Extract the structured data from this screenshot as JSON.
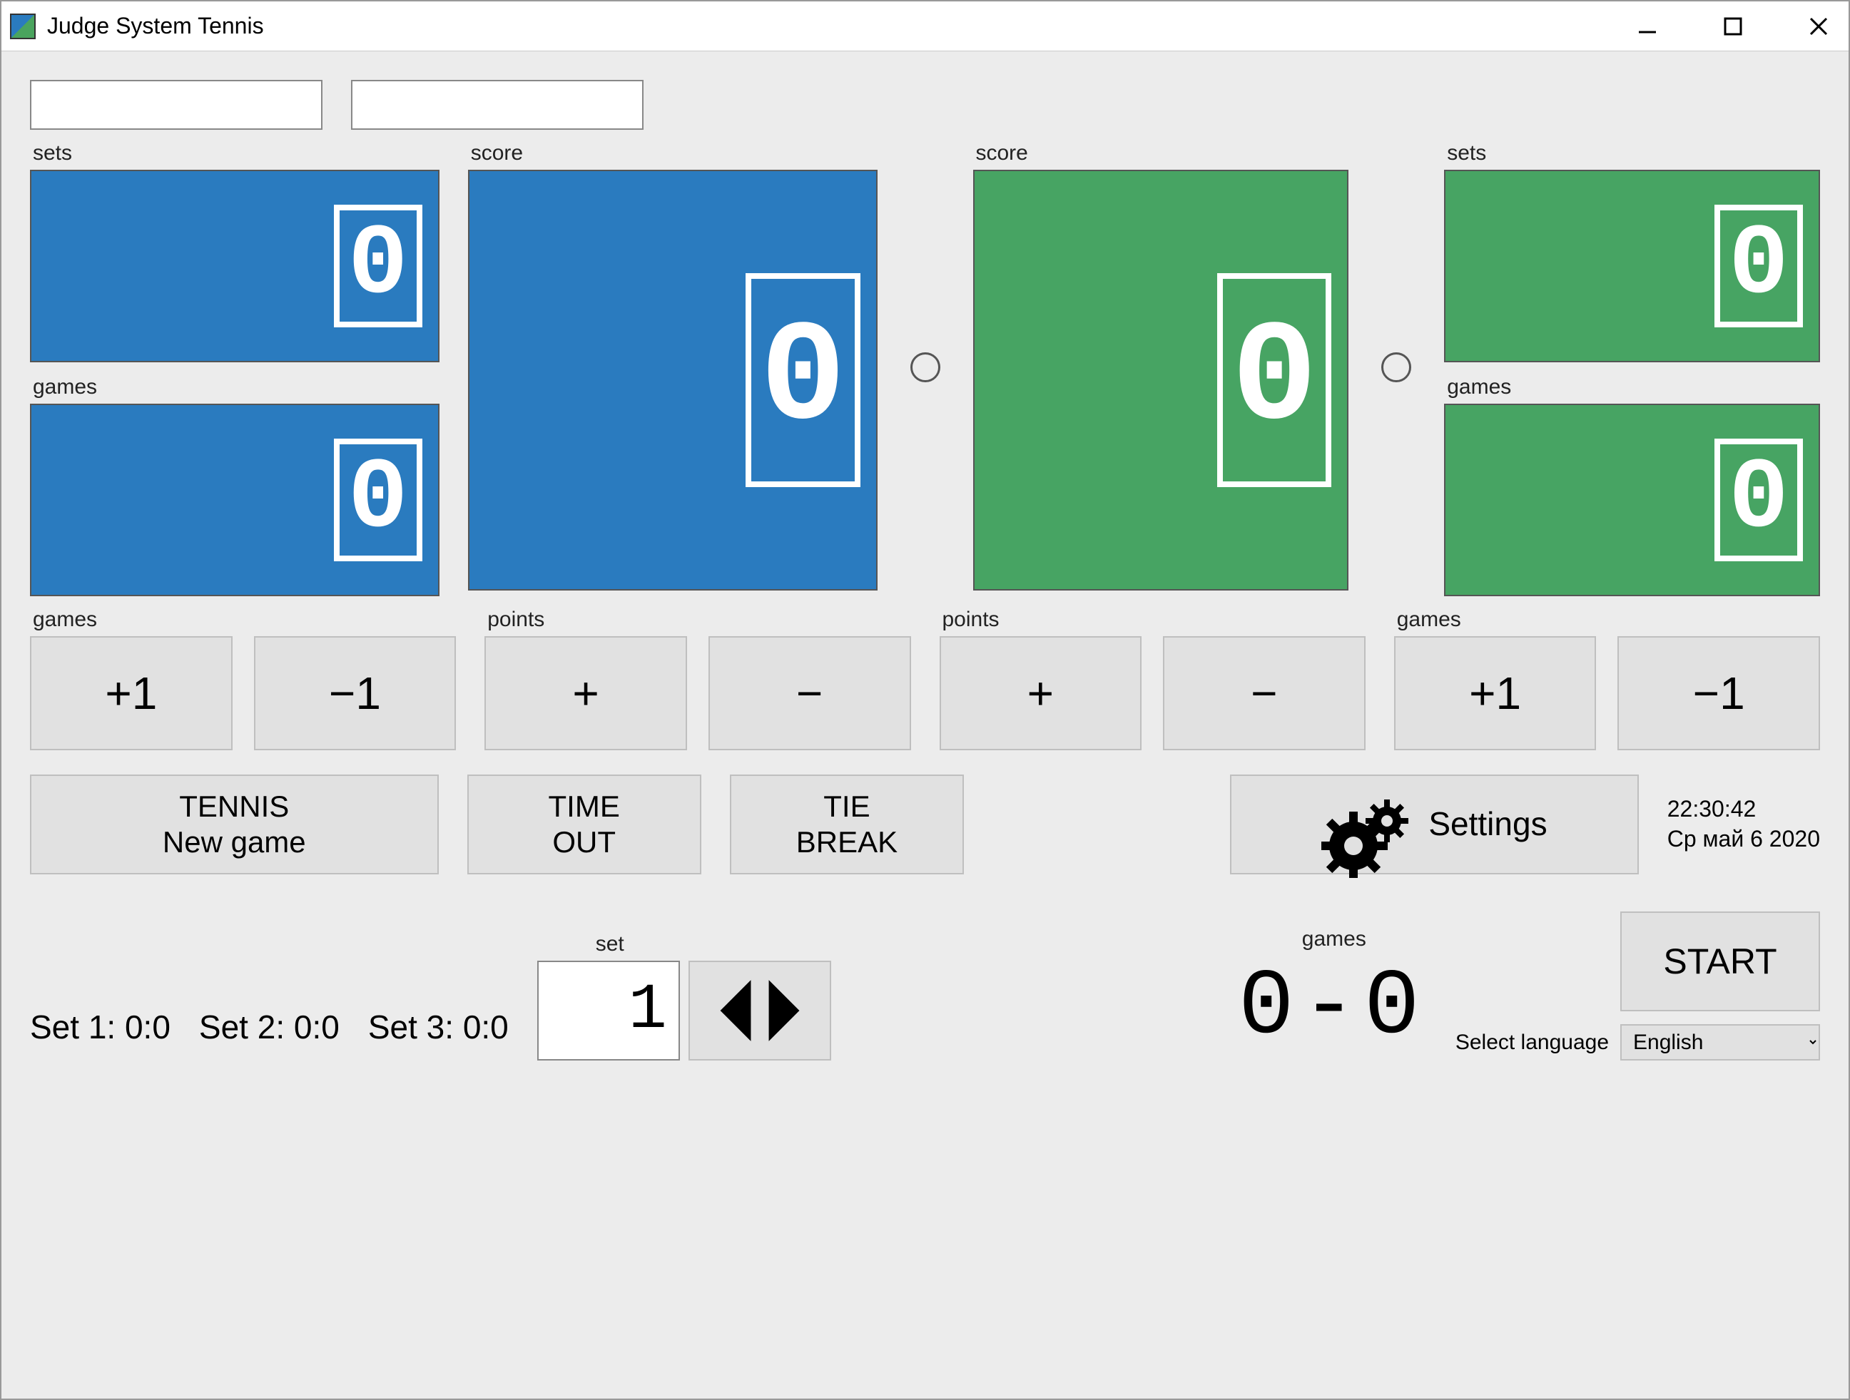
{
  "window": {
    "title": "Judge System Tennis"
  },
  "players": {
    "left_name": "",
    "right_name": ""
  },
  "labels": {
    "sets": "sets",
    "score": "score",
    "games": "games",
    "points": "points",
    "set": "set",
    "select_language": "Select language"
  },
  "scores": {
    "left": {
      "sets": "0",
      "games": "0",
      "score": "0"
    },
    "right": {
      "sets": "0",
      "games": "0",
      "score": "0"
    }
  },
  "buttons": {
    "plus1": "+1",
    "minus1": "−1",
    "plus": "+",
    "minus": "−",
    "tennis_newgame": "TENNIS\nNew game",
    "timeout": "TIME\nOUT",
    "tiebreak": "TIE\nBREAK",
    "settings": "Settings",
    "start": "START"
  },
  "clock": {
    "time": "22:30:42",
    "date": "Ср май 6 2020"
  },
  "sets_summary": {
    "set1": "Set 1: 0:0",
    "set2": "Set 2: 0:0",
    "set3": "Set 3: 0:0"
  },
  "spinner": {
    "set_value": "1"
  },
  "games_display": "0-0",
  "language": {
    "selected": "English",
    "options": [
      "English"
    ]
  }
}
